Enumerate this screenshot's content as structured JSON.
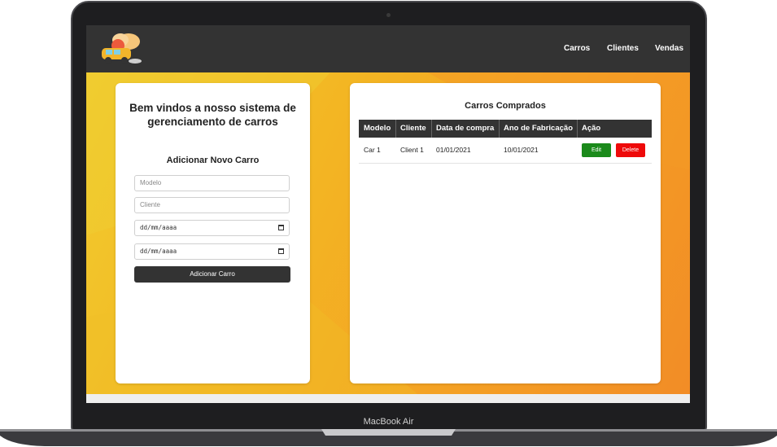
{
  "navbar": {
    "links": [
      {
        "label": "Carros"
      },
      {
        "label": "Clientes"
      },
      {
        "label": "Vendas"
      }
    ]
  },
  "left_panel": {
    "welcome": "Bem vindos a nosso sistema de gerenciamento de carros",
    "form_title": "Adicionar Novo Carro",
    "fields": {
      "modelo_placeholder": "Modelo",
      "cliente_placeholder": "Cliente",
      "date1_value": "dd/mm/aaaa",
      "date2_value": "dd/mm/aaaa"
    },
    "submit_label": "Adicionar Carro"
  },
  "right_panel": {
    "title": "Carros Comprados",
    "columns": [
      "Modelo",
      "Cliente",
      "Data de compra",
      "Ano de Fabricação",
      "Ação"
    ],
    "rows": [
      {
        "modelo": "Car 1",
        "cliente": "Client 1",
        "data_compra": "01/01/2021",
        "ano_fabricacao": "10/01/2021",
        "edit_label": "Edit",
        "delete_label": "Delete"
      }
    ]
  },
  "device": {
    "label": "MacBook Air"
  },
  "colors": {
    "navbar": "#333333",
    "accent_orange": "#f4a81f",
    "edit_green": "#1b8a1b",
    "delete_red": "#ee0a0a"
  }
}
